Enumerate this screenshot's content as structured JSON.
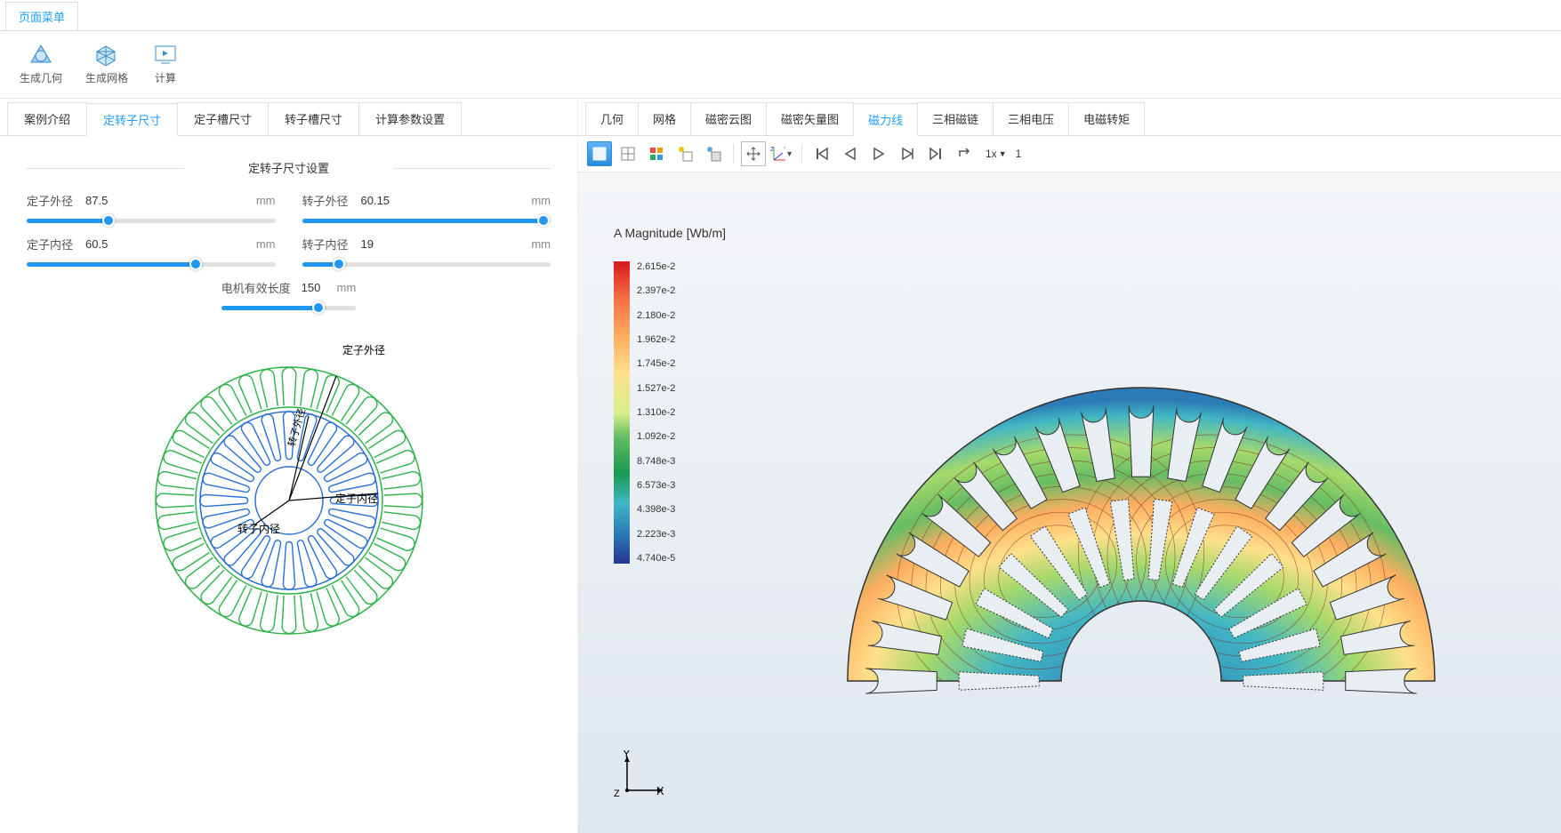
{
  "menu": {
    "page_menu": "页面菜单"
  },
  "toolbar": {
    "gen_geometry": "生成几何",
    "gen_mesh": "生成网格",
    "compute": "计算"
  },
  "left_tabs": [
    "案例介绍",
    "定转子尺寸",
    "定子槽尺寸",
    "转子槽尺寸",
    "计算参数设置"
  ],
  "left_active_tab": 1,
  "section_title": "定转子尺寸设置",
  "params": {
    "stator_outer": {
      "label": "定子外径",
      "value": "87.5",
      "unit": "mm",
      "pct": 33
    },
    "rotor_outer": {
      "label": "转子外径",
      "value": "60.15",
      "unit": "mm",
      "pct": 97
    },
    "stator_inner": {
      "label": "定子内径",
      "value": "60.5",
      "unit": "mm",
      "pct": 68
    },
    "rotor_inner": {
      "label": "转子内径",
      "value": "19",
      "unit": "mm",
      "pct": 15
    },
    "eff_length": {
      "label": "电机有效长度",
      "value": "150",
      "unit": "mm",
      "pct": 72
    }
  },
  "diagram_labels": {
    "stator_outer": "定子外径",
    "rotor_outer": "转子外径",
    "stator_inner": "定子内径",
    "rotor_inner": "转子内径"
  },
  "right_tabs": [
    "几何",
    "网格",
    "磁密云图",
    "磁密矢量图",
    "磁力线",
    "三相磁链",
    "三相电压",
    "电磁转矩"
  ],
  "right_active_tab": 4,
  "playback": {
    "speed": "1x",
    "frame": "1"
  },
  "viewport": {
    "field_title": "A Magnitude [Wb/m]",
    "legend": [
      "2.615e-2",
      "2.397e-2",
      "2.180e-2",
      "1.962e-2",
      "1.745e-2",
      "1.527e-2",
      "1.310e-2",
      "1.092e-2",
      "8.748e-3",
      "6.573e-3",
      "4.398e-3",
      "2.223e-3",
      "4.740e-5"
    ],
    "axes": {
      "x": "X",
      "y": "Y",
      "z": "Z"
    }
  }
}
